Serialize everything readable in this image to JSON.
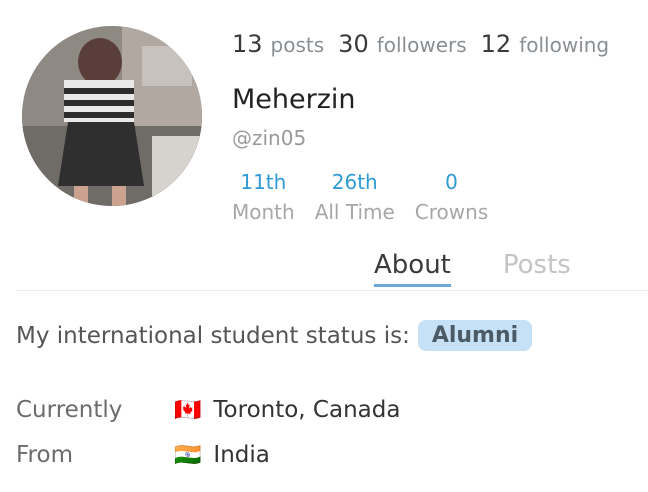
{
  "profile": {
    "name": "Meherzin",
    "handle": "@zin05",
    "stats": [
      {
        "count": "13",
        "label": "posts"
      },
      {
        "count": "30",
        "label": "followers"
      },
      {
        "count": "12",
        "label": "following"
      }
    ],
    "ranks": [
      {
        "value": "11th",
        "label": "Month"
      },
      {
        "value": "26th",
        "label": "All Time"
      },
      {
        "value": "0",
        "label": "Crowns"
      }
    ]
  },
  "tabs": [
    {
      "label": "About",
      "active": true
    },
    {
      "label": "Posts",
      "active": false
    }
  ],
  "about": {
    "status_text": "My international student status is:",
    "status_badge": "Alumni",
    "currently_label": "Currently",
    "currently_flag": "🇨🇦",
    "currently_value": "Toronto, Canada",
    "from_label": "From",
    "from_flag": "🇮🇳",
    "from_value": "India"
  },
  "colors": {
    "accent": "#2e9bd6",
    "badge_bg": "#c6e1f5",
    "tab_underline": "#6aa9d8"
  }
}
